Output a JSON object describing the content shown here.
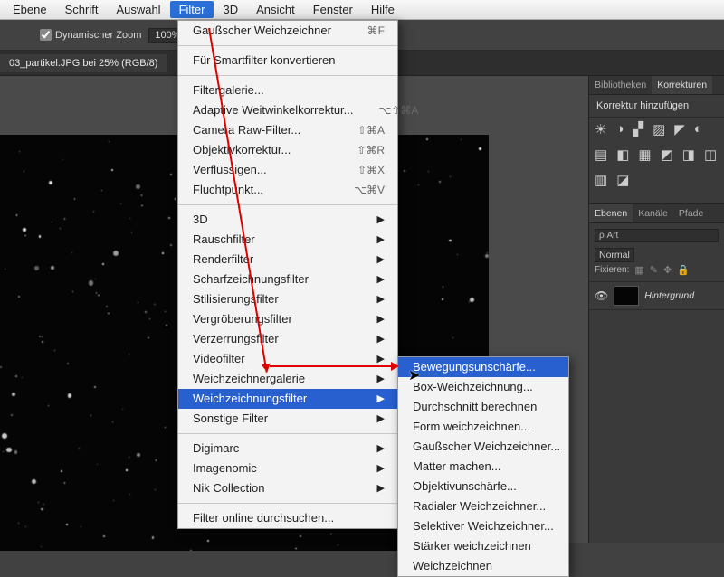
{
  "menubar": {
    "items": [
      "Ebene",
      "Schrift",
      "Auswahl",
      "Filter",
      "3D",
      "Ansicht",
      "Fenster",
      "Hilfe"
    ],
    "active_index": 3
  },
  "optionsbar": {
    "dyn_zoom_label": "Dynamischer Zoom",
    "zoom_value": "100%"
  },
  "document": {
    "tab_label": "03_partikel.JPG bei 25% (RGB/8)"
  },
  "filter_menu": {
    "groups": [
      [
        {
          "label": "Gaußscher Weichzeichner",
          "shortcut": "⌘F"
        }
      ],
      [
        {
          "label": "Für Smartfilter konvertieren"
        }
      ],
      [
        {
          "label": "Filtergalerie..."
        },
        {
          "label": "Adaptive Weitwinkelkorrektur...",
          "shortcut": "⌥⇧⌘A"
        },
        {
          "label": "Camera Raw-Filter...",
          "shortcut": "⇧⌘A"
        },
        {
          "label": "Objektivkorrektur...",
          "shortcut": "⇧⌘R"
        },
        {
          "label": "Verflüssigen...",
          "shortcut": "⇧⌘X"
        },
        {
          "label": "Fluchtpunkt...",
          "shortcut": "⌥⌘V"
        }
      ],
      [
        {
          "label": "3D",
          "submenu": true
        },
        {
          "label": "Rauschfilter",
          "submenu": true
        },
        {
          "label": "Renderfilter",
          "submenu": true
        },
        {
          "label": "Scharfzeichnungsfilter",
          "submenu": true
        },
        {
          "label": "Stilisierungsfilter",
          "submenu": true
        },
        {
          "label": "Vergröberungsfilter",
          "submenu": true
        },
        {
          "label": "Verzerrungsfilter",
          "submenu": true
        },
        {
          "label": "Videofilter",
          "submenu": true
        },
        {
          "label": "Weichzeichnergalerie",
          "submenu": true
        },
        {
          "label": "Weichzeichnungsfilter",
          "submenu": true,
          "selected": true
        },
        {
          "label": "Sonstige Filter",
          "submenu": true
        }
      ],
      [
        {
          "label": "Digimarc",
          "submenu": true
        },
        {
          "label": "Imagenomic",
          "submenu": true
        },
        {
          "label": "Nik Collection",
          "submenu": true
        }
      ],
      [
        {
          "label": "Filter online durchsuchen..."
        }
      ]
    ]
  },
  "blur_submenu": {
    "items": [
      {
        "label": "Bewegungsunschärfe...",
        "selected": true
      },
      {
        "label": "Box-Weichzeichnung..."
      },
      {
        "label": "Durchschnitt berechnen"
      },
      {
        "label": "Form weichzeichnen..."
      },
      {
        "label": "Gaußscher Weichzeichner..."
      },
      {
        "label": "Matter machen..."
      },
      {
        "label": "Objektivunschärfe..."
      },
      {
        "label": "Radialer Weichzeichner..."
      },
      {
        "label": "Selektiver Weichzeichner..."
      },
      {
        "label": "Stärker weichzeichnen"
      },
      {
        "label": "Weichzeichnen"
      }
    ]
  },
  "right": {
    "top_tabs": [
      "Bibliotheken",
      "Korrekturen"
    ],
    "top_tabs_active": 1,
    "adj_header": "Korrektur hinzufügen",
    "adj_icons": [
      "☀",
      "◑",
      "▞",
      "▨",
      "◤",
      "◐",
      "▤",
      "◧",
      "▦",
      "◩",
      "◨",
      "◫",
      "▥",
      "◪"
    ],
    "layer_tabs": [
      "Ebenen",
      "Kanäle",
      "Pfade"
    ],
    "layer_tabs_active": 0,
    "search_kind": "ρ Art",
    "blend_mode": "Normal",
    "fix_label": "Fixieren:",
    "layer": {
      "name": "Hintergrund"
    }
  }
}
